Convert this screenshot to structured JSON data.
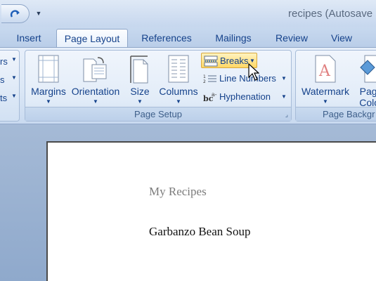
{
  "window": {
    "title": "recipes (Autosave"
  },
  "tabs": [
    {
      "label": "Insert"
    },
    {
      "label": "Page Layout",
      "active": true
    },
    {
      "label": "References"
    },
    {
      "label": "Mailings"
    },
    {
      "label": "Review"
    },
    {
      "label": "View"
    }
  ],
  "ribbon": {
    "left_group_fragments": [
      "rs",
      "s",
      "ts"
    ],
    "page_setup": {
      "label": "Page Setup",
      "margins": "Margins",
      "orientation": "Orientation",
      "size": "Size",
      "columns": "Columns",
      "breaks": "Breaks",
      "line_numbers": "Line Numbers",
      "hyphenation": "Hyphenation"
    },
    "page_background": {
      "label": "Page Backgr",
      "watermark": "Watermark",
      "page_color_1": "Page",
      "page_color_2": "Color"
    }
  },
  "document": {
    "title": "My Recipes",
    "heading": "Garbanzo Bean Soup"
  },
  "colors": {
    "ribbon_text": "#15428b",
    "highlight": "#ffd866"
  }
}
